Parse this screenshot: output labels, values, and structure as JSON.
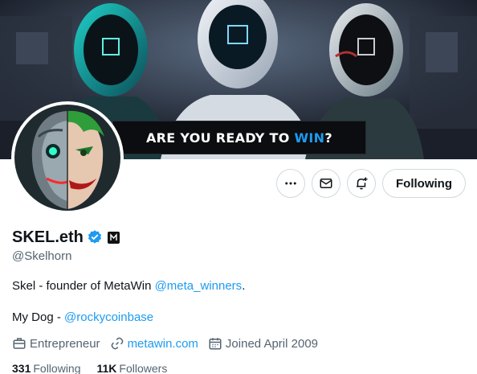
{
  "banner": {
    "headline_prefix": "ARE YOU READY TO",
    "headline_accent": "WIN",
    "headline_suffix": "?"
  },
  "actions": {
    "more_icon": "more-horizontal-icon",
    "message_icon": "envelope-icon",
    "notify_icon": "bell-plus-icon",
    "follow_label": "Following"
  },
  "profile": {
    "name": "SKEL.eth",
    "handle": "@Skelhorn",
    "bio_text": "Skel - founder of MetaWin ",
    "bio_mention": "@meta_winners",
    "bio_end": ".",
    "bio2_text": "My Dog - ",
    "bio2_mention": "@rockycoinbase",
    "profession": "Entrepreneur",
    "website": "metawin.com",
    "joined": "Joined April 2009",
    "following_count": "331",
    "following_label": "Following",
    "followers_count": "11K",
    "followers_label": "Followers"
  },
  "colors": {
    "accent": "#1d9bf0",
    "muted": "#536471",
    "text": "#0f1419"
  }
}
